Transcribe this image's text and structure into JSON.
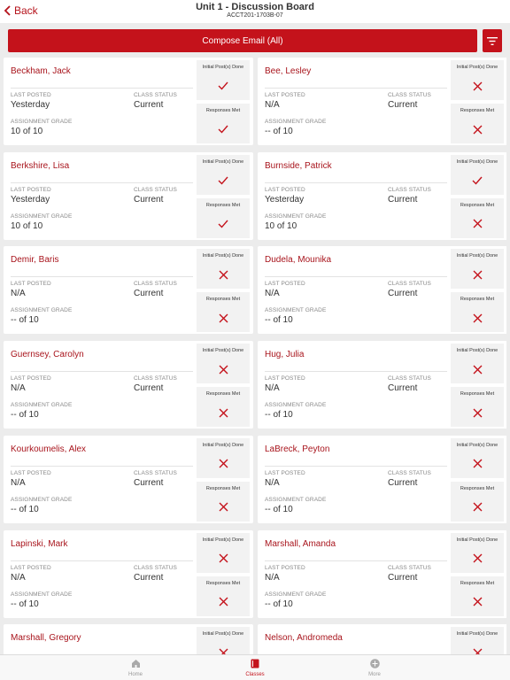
{
  "header": {
    "back_label": "Back",
    "title": "Unit 1 - Discussion Board",
    "subtitle": "ACCT201-1703B-07"
  },
  "toolbar": {
    "compose_label": "Compose Email (All)",
    "filter_icon": "filter-icon"
  },
  "labels": {
    "last_posted": "LAST POSTED",
    "class_status": "CLASS STATUS",
    "assignment_grade": "ASSIGNMENT GRADE",
    "initial_posts": "Initial Post(s) Done",
    "responses_met": "Responses Met"
  },
  "colors": {
    "accent": "#c4121b",
    "name": "#a8141c"
  },
  "students": [
    {
      "name": "Beckham, Jack",
      "last_posted": "Yesterday",
      "class_status": "Current",
      "grade": "10 of 10",
      "initial_done": true,
      "responses_met": true
    },
    {
      "name": "Bee, Lesley",
      "last_posted": "N/A",
      "class_status": "Current",
      "grade": "-- of 10",
      "initial_done": false,
      "responses_met": false
    },
    {
      "name": "Berkshire, Lisa",
      "last_posted": "Yesterday",
      "class_status": "Current",
      "grade": "10 of 10",
      "initial_done": true,
      "responses_met": true
    },
    {
      "name": "Burnside, Patrick",
      "last_posted": "Yesterday",
      "class_status": "Current",
      "grade": "10 of 10",
      "initial_done": true,
      "responses_met": false
    },
    {
      "name": "Demir, Baris",
      "last_posted": "N/A",
      "class_status": "Current",
      "grade": "-- of 10",
      "initial_done": false,
      "responses_met": false
    },
    {
      "name": "Dudela, Mounika",
      "last_posted": "N/A",
      "class_status": "Current",
      "grade": "-- of 10",
      "initial_done": false,
      "responses_met": false
    },
    {
      "name": "Guernsey, Carolyn",
      "last_posted": "N/A",
      "class_status": "Current",
      "grade": "-- of 10",
      "initial_done": false,
      "responses_met": false
    },
    {
      "name": "Hug, Julia",
      "last_posted": "N/A",
      "class_status": "Current",
      "grade": "-- of 10",
      "initial_done": false,
      "responses_met": false
    },
    {
      "name": "Kourkoumelis, Alex",
      "last_posted": "N/A",
      "class_status": "Current",
      "grade": "-- of 10",
      "initial_done": false,
      "responses_met": false
    },
    {
      "name": "LaBreck, Peyton",
      "last_posted": "N/A",
      "class_status": "Current",
      "grade": "-- of 10",
      "initial_done": false,
      "responses_met": false
    },
    {
      "name": "Lapinski, Mark",
      "last_posted": "N/A",
      "class_status": "Current",
      "grade": "-- of 10",
      "initial_done": false,
      "responses_met": false
    },
    {
      "name": "Marshall, Amanda",
      "last_posted": "N/A",
      "class_status": "Current",
      "grade": "-- of 10",
      "initial_done": false,
      "responses_met": false
    },
    {
      "name": "Marshall, Gregory",
      "last_posted": "",
      "class_status": "",
      "grade": "",
      "initial_done": false,
      "responses_met": false
    },
    {
      "name": "Nelson, Andromeda",
      "last_posted": "",
      "class_status": "",
      "grade": "",
      "initial_done": false,
      "responses_met": false
    }
  ],
  "tabs": [
    {
      "label": "Home",
      "icon": "home-icon",
      "active": false
    },
    {
      "label": "Classes",
      "icon": "book-icon",
      "active": true
    },
    {
      "label": "More",
      "icon": "more-icon",
      "active": false
    }
  ]
}
